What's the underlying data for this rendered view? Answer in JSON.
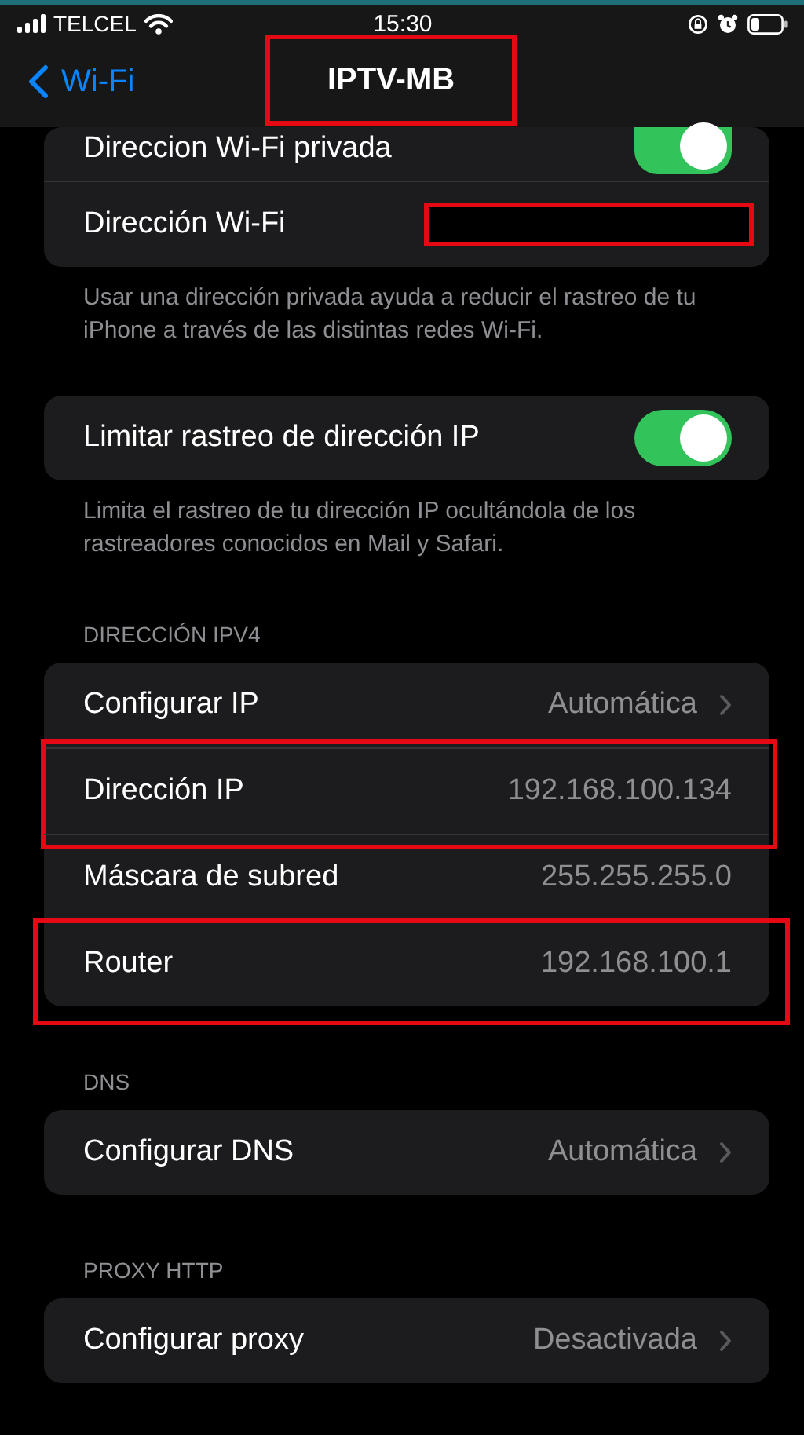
{
  "status_bar": {
    "carrier": "TELCEL",
    "time": "15:30"
  },
  "nav": {
    "back": "Wi-Fi",
    "title": "IPTV-MB",
    "highlighted": true
  },
  "sections": [
    {
      "rows": [
        {
          "kind": "toggle",
          "label": "Direccion Wi-Fi privada",
          "on": true,
          "partial": true
        },
        {
          "kind": "value",
          "label": "Dirección Wi-Fi",
          "redacted": true
        }
      ],
      "footer": "Usar una dirección privada ayuda a reducir el rastreo de tu iPhone a través de las distintas redes Wi-Fi."
    },
    {
      "rows": [
        {
          "kind": "toggle",
          "label": "Limitar rastreo de dirección IP",
          "on": true
        }
      ],
      "footer": "Limita el rastreo de tu dirección IP ocultándola de los rastreadores conocidos en Mail y Safari."
    },
    {
      "header": "DIRECCIÓN IPV4",
      "rows": [
        {
          "kind": "link",
          "label": "Configurar IP",
          "value": "Automática"
        },
        {
          "kind": "value",
          "label": "Dirección IP",
          "value": "192.168.100.134",
          "highlighted": true
        },
        {
          "kind": "value",
          "label": "Máscara de subred",
          "value": "255.255.255.0"
        },
        {
          "kind": "value",
          "label": "Router",
          "value": "192.168.100.1",
          "highlighted": true
        }
      ]
    },
    {
      "header": "DNS",
      "rows": [
        {
          "kind": "link",
          "label": "Configurar DNS",
          "value": "Automática"
        }
      ]
    },
    {
      "header": "PROXY HTTP",
      "rows": [
        {
          "kind": "link",
          "label": "Configurar proxy",
          "value": "Desactivada"
        }
      ]
    }
  ]
}
